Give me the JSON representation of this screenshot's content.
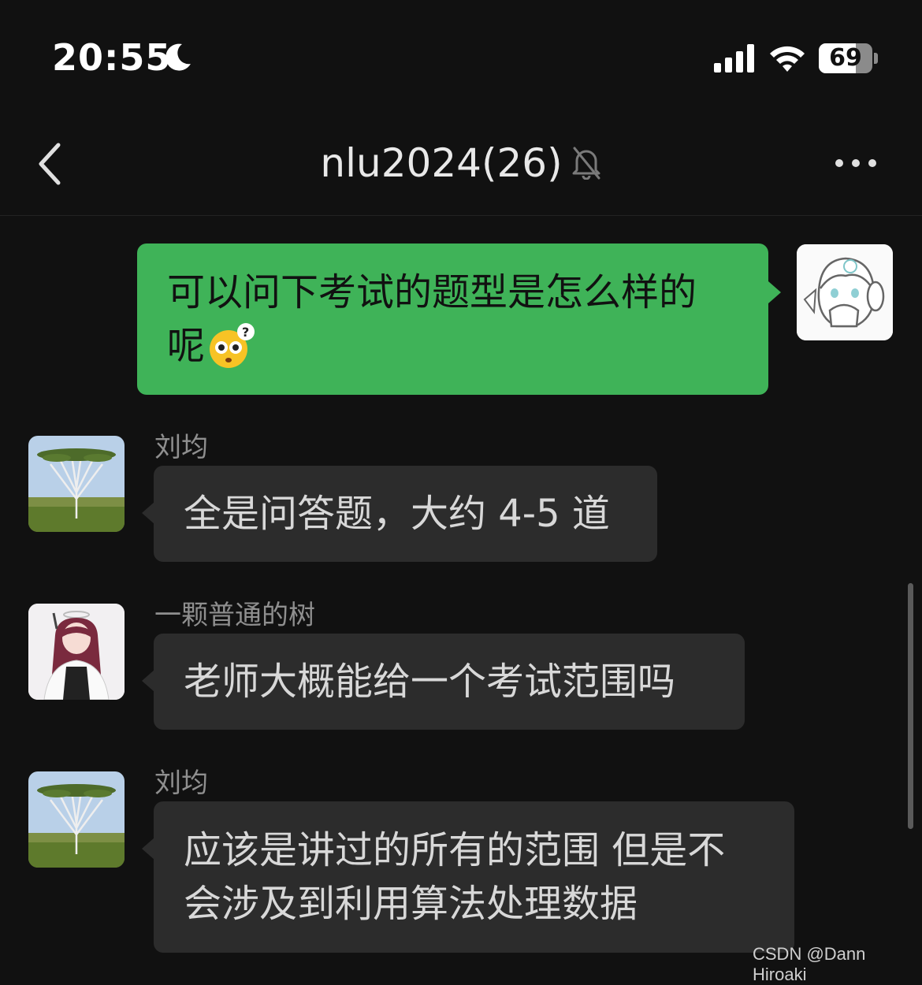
{
  "status_bar": {
    "time": "20:55",
    "battery_level": "69",
    "battery_fraction": 0.69,
    "icons": [
      "moon-icon",
      "cellular-signal-icon",
      "wifi-icon",
      "battery-icon"
    ]
  },
  "header": {
    "title": "nlu2024(26)",
    "icons": [
      "back-chevron-icon",
      "muted-bell-icon",
      "more-dots-icon"
    ]
  },
  "messages": [
    {
      "direction": "out",
      "text_line1": "可以问下考试的题型是怎么样的",
      "text_line2": "呢",
      "emoji": "puzzled-face-emoji"
    },
    {
      "direction": "in",
      "sender": "刘均",
      "text": "全是问答题，大约 4-5 道"
    },
    {
      "direction": "in",
      "sender": "一颗普通的树",
      "text": "老师大概能给一个考试范围吗"
    },
    {
      "direction": "in",
      "sender": "刘均",
      "text_line1": "应该是讲过的所有的范围 但是不",
      "text_line2": "会涉及到利用算法处理数据"
    }
  ],
  "colors": {
    "background": "#111111",
    "outgoing_bubble": "#3fb358",
    "incoming_bubble": "#2c2c2c",
    "sender_name": "#8f8f8f"
  },
  "watermark": "CSDN @Dann Hiroaki"
}
